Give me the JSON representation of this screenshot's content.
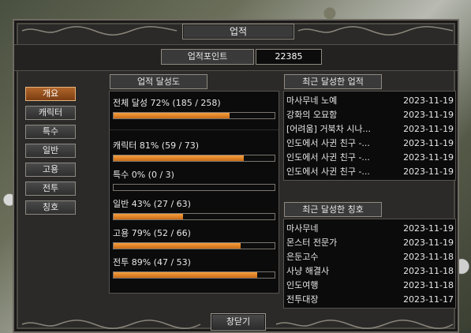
{
  "window": {
    "title": "업적"
  },
  "points": {
    "label": "업적포인트",
    "value": "22385"
  },
  "sidebar": {
    "items": [
      {
        "label": "개요",
        "active": true
      },
      {
        "label": "캐릭터",
        "active": false
      },
      {
        "label": "특수",
        "active": false
      },
      {
        "label": "일반",
        "active": false
      },
      {
        "label": "고용",
        "active": false
      },
      {
        "label": "전투",
        "active": false
      },
      {
        "label": "칭호",
        "active": false
      }
    ]
  },
  "progress": {
    "header": "업적 달성도",
    "overall": {
      "label": "전체 달성 72% (185 / 258)",
      "percent": 72
    },
    "categories": [
      {
        "label": "캐릭터 81% (59 / 73)",
        "percent": 81
      },
      {
        "label": "특수 0% (0 / 3)",
        "percent": 0
      },
      {
        "label": "일반 43% (27 / 63)",
        "percent": 43
      },
      {
        "label": "고용 79% (52 / 66)",
        "percent": 79
      },
      {
        "label": "전투 89% (47 / 53)",
        "percent": 89
      }
    ]
  },
  "recent_achievements": {
    "header": "최근 달성한 업적",
    "rows": [
      {
        "name": "마사무네 노예",
        "date": "2023-11-19"
      },
      {
        "name": "강화의 오묘함",
        "date": "2023-11-19"
      },
      {
        "name": "[어려움] 거북차 시나...",
        "date": "2023-11-19"
      },
      {
        "name": "인도에서 사귄 친구 -...",
        "date": "2023-11-19"
      },
      {
        "name": "인도에서 사귄 친구 -...",
        "date": "2023-11-19"
      },
      {
        "name": "인도에서 사귄 친구 -...",
        "date": "2023-11-19"
      }
    ]
  },
  "recent_titles": {
    "header": "최근 달성한 칭호",
    "rows": [
      {
        "name": "마사무네",
        "date": "2023-11-19"
      },
      {
        "name": "몬스터 전문가",
        "date": "2023-11-19"
      },
      {
        "name": "은둔고수",
        "date": "2023-11-18"
      },
      {
        "name": "사냥 해결사",
        "date": "2023-11-18"
      },
      {
        "name": "인도여행",
        "date": "2023-11-18"
      },
      {
        "name": "전투대장",
        "date": "2023-11-17"
      }
    ]
  },
  "footer": {
    "close_label": "창닫기"
  },
  "colors": {
    "accent": "#e08a2a",
    "active_tab": "#9a5220",
    "panel_bg": "#0b0b0b",
    "frame": "#2b2a28"
  }
}
